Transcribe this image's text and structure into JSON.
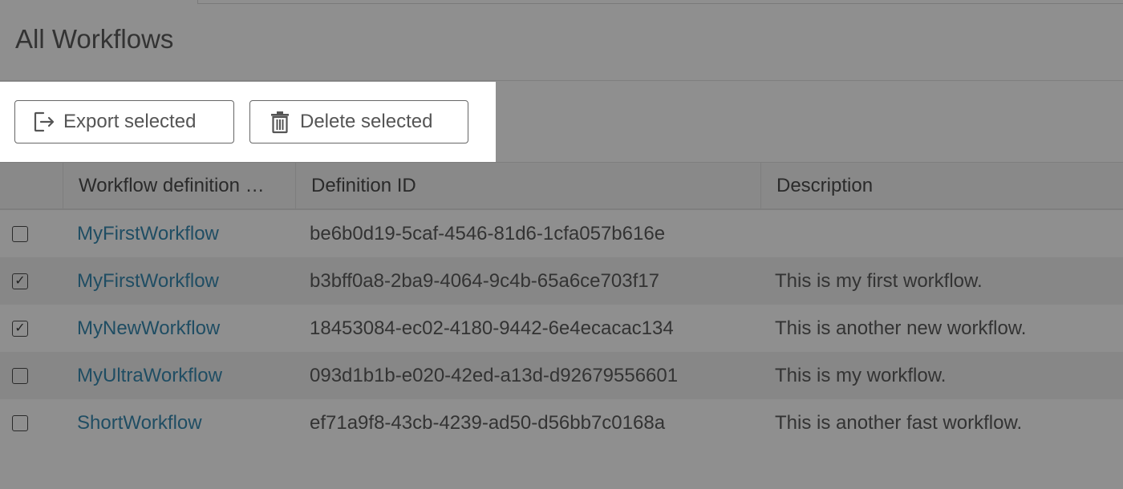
{
  "page": {
    "title": "All Workflows"
  },
  "toolbar": {
    "export_label": "Export selected",
    "export_icon": "export-icon",
    "delete_label": "Delete selected",
    "delete_icon": "trash-icon"
  },
  "table": {
    "columns": [
      "",
      "Workflow definition …",
      "Definition ID",
      "Description"
    ],
    "rows": [
      {
        "checked": false,
        "check_glyph": "",
        "name": "MyFirstWorkflow",
        "id": "be6b0d19-5caf-4546-81d6-1cfa057b616e",
        "description": ""
      },
      {
        "checked": true,
        "check_glyph": "✓",
        "name": "MyFirstWorkflow",
        "id": "b3bff0a8-2ba9-4064-9c4b-65a6ce703f17",
        "description": "This is my first workflow."
      },
      {
        "checked": true,
        "check_glyph": "✓",
        "name": "MyNewWorkflow",
        "id": "18453084-ec02-4180-9442-6e4ecacac134",
        "description": "This is another new workflow."
      },
      {
        "checked": false,
        "check_glyph": "",
        "name": "MyUltraWorkflow",
        "id": "093d1b1b-e020-42ed-a13d-d92679556601",
        "description": "This is my workflow."
      },
      {
        "checked": false,
        "check_glyph": "",
        "name": "ShortWorkflow",
        "id": "ef71a9f8-43cb-4239-ad50-d56bb7c0168a",
        "description": "This is another fast workflow."
      }
    ]
  },
  "colors": {
    "overlay_bg": "#8f8f8f",
    "highlight_bg": "#ffffff",
    "link": "#1f4d63"
  }
}
